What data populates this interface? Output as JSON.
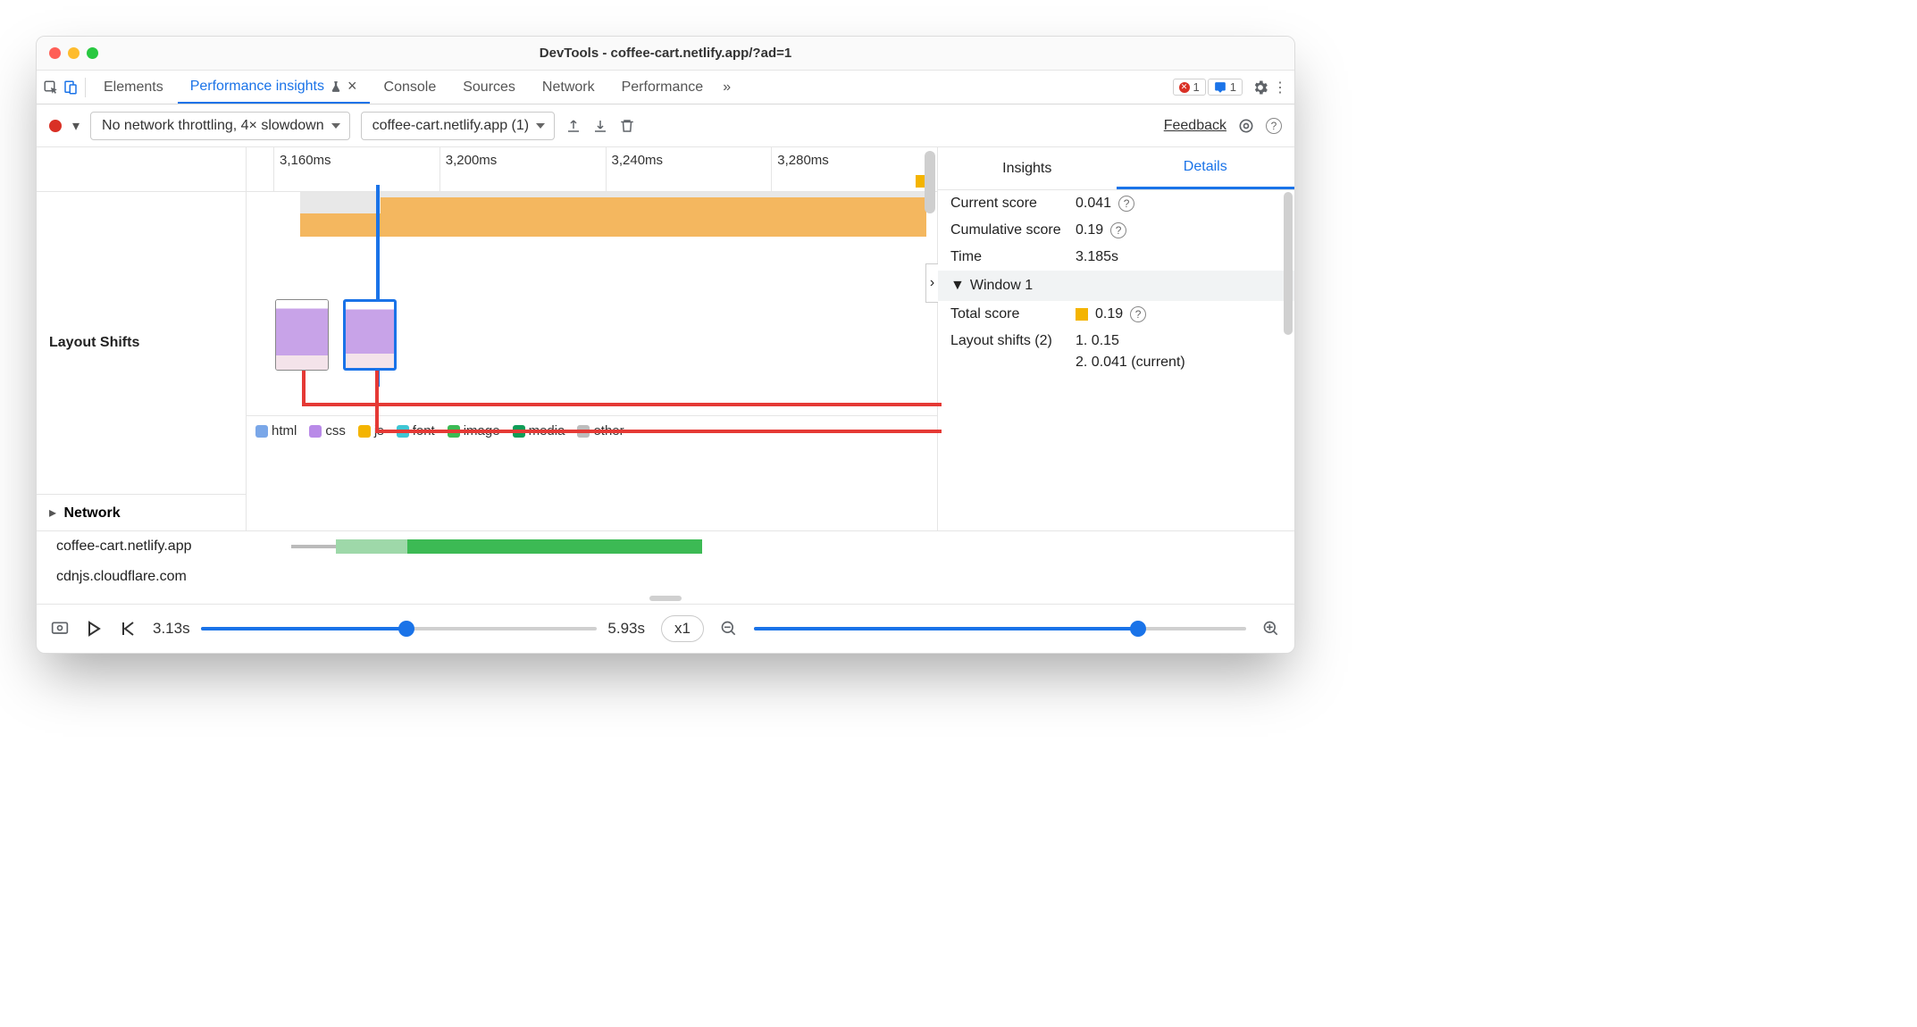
{
  "window_title": "DevTools - coffee-cart.netlify.app/?ad=1",
  "tabs": {
    "elements": "Elements",
    "perf_insights": "Performance insights",
    "console": "Console",
    "sources": "Sources",
    "network": "Network",
    "performance": "Performance"
  },
  "error_count": "1",
  "issue_count": "1",
  "toolbar": {
    "throttling": "No network throttling, 4× slowdown",
    "page_select": "coffee-cart.netlify.app (1)",
    "feedback": "Feedback"
  },
  "ruler": {
    "t1": "3,160ms",
    "t2": "3,200ms",
    "t3": "3,240ms",
    "t4": "3,280ms"
  },
  "sections": {
    "layout_shifts": "Layout Shifts",
    "network": "Network"
  },
  "legend": {
    "html": "html",
    "css": "css",
    "js": "js",
    "font": "font",
    "image": "image",
    "media": "media",
    "other": "other"
  },
  "net_rows": {
    "r1": "coffee-cart.netlify.app",
    "r2": "cdnjs.cloudflare.com"
  },
  "right": {
    "tab_insights": "Insights",
    "tab_details": "Details",
    "current_score_k": "Current score",
    "current_score_v": "0.041",
    "cumulative_k": "Cumulative score",
    "cumulative_v": "0.19",
    "time_k": "Time",
    "time_v": "3.185s",
    "window_h": "Window 1",
    "total_score_k": "Total score",
    "total_score_v": "0.19",
    "layout_shifts_k": "Layout shifts (2)",
    "ls1": "1. 0.15",
    "ls2": "2. 0.041 (current)"
  },
  "footer": {
    "time_start": "3.13s",
    "time_end": "5.93s",
    "speed": "x1"
  }
}
